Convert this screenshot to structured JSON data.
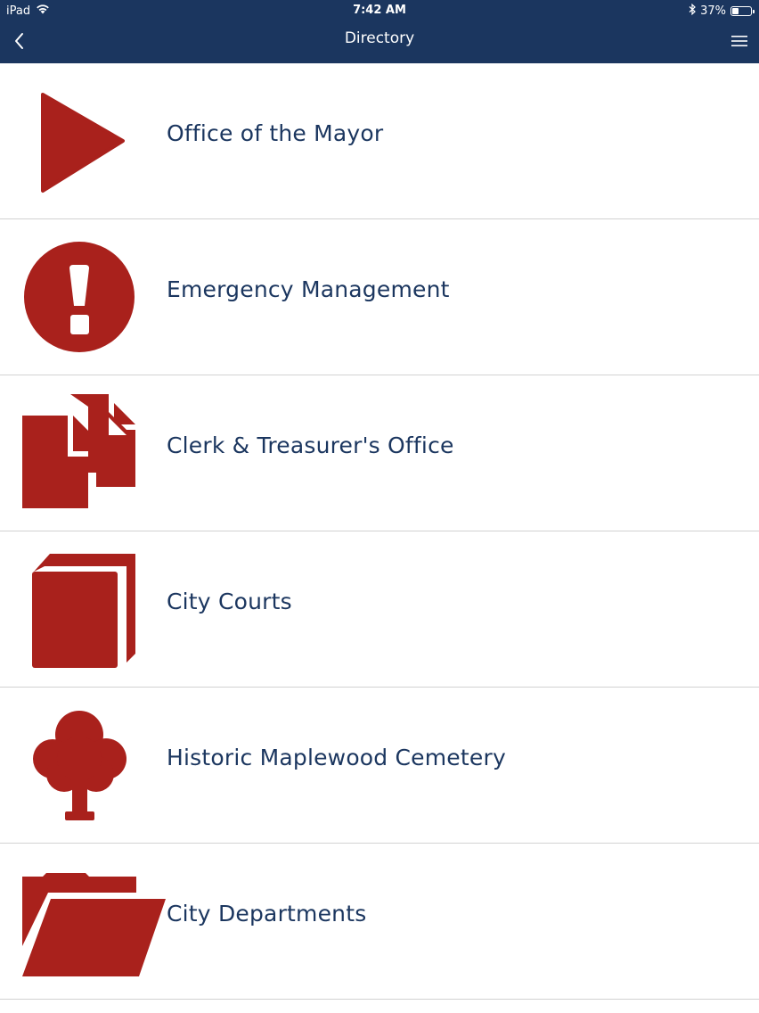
{
  "status_bar": {
    "device": "iPad",
    "time": "7:42 AM",
    "battery_percent": "37%",
    "battery_level": 0.37,
    "wifi_icon": "wifi-icon",
    "bluetooth_icon": "bluetooth-icon"
  },
  "nav": {
    "title": "Directory",
    "back_icon": "chevron-left-icon",
    "menu_icon": "hamburger-menu-icon"
  },
  "colors": {
    "header_bg": "#1b365f",
    "icon_red": "#a9211c",
    "label_navy": "#1b365f",
    "divider": "#d2d2d2"
  },
  "directory": {
    "items": [
      {
        "label": "Office of the Mayor",
        "icon": "play-triangle-icon"
      },
      {
        "label": "Emergency Management",
        "icon": "exclamation-circle-icon"
      },
      {
        "label": "Clerk & Treasurer's Office",
        "icon": "documents-icon"
      },
      {
        "label": "City Courts",
        "icon": "book-icon"
      },
      {
        "label": "Historic Maplewood Cemetery",
        "icon": "tree-icon"
      },
      {
        "label": "City Departments",
        "icon": "folder-open-icon"
      }
    ]
  }
}
